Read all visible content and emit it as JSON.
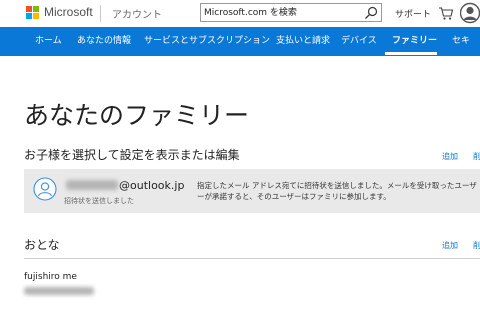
{
  "header": {
    "brand": "Microsoft",
    "account_label": "アカウント",
    "search_placeholder": "Microsoft.com を検索",
    "support_label": "サポート",
    "logo_colors": [
      "#f25022",
      "#7fba00",
      "#00a4ef",
      "#ffb900"
    ]
  },
  "nav": {
    "items": [
      {
        "label": "ホーム"
      },
      {
        "label": "あなたの情報"
      },
      {
        "label": "サービスとサブスクリプション"
      },
      {
        "label": "支払いと請求"
      },
      {
        "label": "デバイス"
      },
      {
        "label": "ファミリー",
        "active": true
      },
      {
        "label": "セキ"
      }
    ],
    "bg_color": "#0a78d7"
  },
  "main": {
    "title": "あなたのファミリー",
    "children_section": {
      "heading": "お子様を選択して設定を表示または編集",
      "add_link": "追加",
      "more_link": "削",
      "child": {
        "email_domain": "@outlook.jp",
        "status": "招待状を送信しました",
        "message": "指定したメール アドレス宛てに招待状を送信しました。メールを受け取ったユーザーが承諾すると、そのユーザーはファミリに参加します。"
      }
    },
    "adults_section": {
      "heading": "おとな",
      "add_link": "追加",
      "more_link": "削",
      "adult": {
        "name": "fujishiro me"
      }
    }
  }
}
